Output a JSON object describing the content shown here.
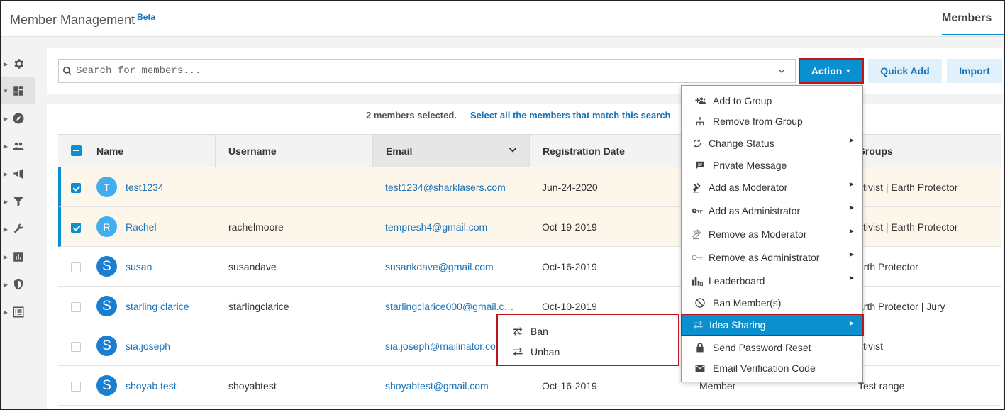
{
  "header": {
    "title": "Member Management",
    "badge": "Beta",
    "tab": "Members"
  },
  "sidebar": {
    "items": [
      {
        "icon": "gear-icon"
      },
      {
        "icon": "dashboard-icon",
        "active": true
      },
      {
        "icon": "compass-icon"
      },
      {
        "icon": "people-icon"
      },
      {
        "icon": "megaphone-icon"
      },
      {
        "icon": "filter-icon"
      },
      {
        "icon": "wrench-icon"
      },
      {
        "icon": "bar-chart-icon"
      },
      {
        "icon": "shield-icon"
      },
      {
        "icon": "list-icon"
      }
    ]
  },
  "search": {
    "placeholder": "Search for members...",
    "value": ""
  },
  "toolbar": {
    "action_label": "Action",
    "quick_add_label": "Quick Add",
    "import_label": "Import"
  },
  "selection": {
    "count_text": "2 members selected.",
    "select_all_text": "Select all the members that match this search"
  },
  "table": {
    "columns": [
      "Name",
      "Username",
      "Email",
      "Registration Date",
      "",
      "Groups"
    ],
    "rows": [
      {
        "initial": "T",
        "name": "test1234",
        "username": "",
        "email": "test1234@sharklasers.com",
        "date": "Jun-24-2020",
        "status": "",
        "groups": "ctivist | Earth Protector",
        "selected": true
      },
      {
        "initial": "R",
        "name": "Rachel",
        "username": "rachelmoore",
        "email": "tempresh4@gmail.com",
        "date": "Oct-19-2019",
        "status": "",
        "groups": "ctivist | Earth Protector",
        "selected": true
      },
      {
        "initial": "S",
        "name": "susan",
        "username": "susandave",
        "email": "susankdave@gmail.com",
        "date": "Oct-16-2019",
        "status": "",
        "groups": "arth Protector",
        "selected": false
      },
      {
        "initial": "S",
        "name": "starling clarice",
        "username": "starlingclarice",
        "email": "starlingclarice000@gmail.c…",
        "date": "Oct-10-2019",
        "status": "",
        "groups": "arth Protector | Jury",
        "selected": false
      },
      {
        "initial": "S",
        "name": "sia.joseph",
        "username": "",
        "email": "sia.joseph@mailinator.cor",
        "date": "",
        "status": "",
        "groups": "ctivist",
        "selected": false
      },
      {
        "initial": "S",
        "name": "shoyab test",
        "username": "shoyabtest",
        "email": "shoyabtest@gmail.com",
        "date": "Oct-16-2019",
        "status": "Member",
        "groups": "Test range",
        "selected": false
      }
    ]
  },
  "action_menu": {
    "items": [
      {
        "label": "Add to Group",
        "icon": "add-group-icon",
        "submenu": false
      },
      {
        "label": "Remove from Group",
        "icon": "hierarchy-icon",
        "submenu": false
      },
      {
        "label": "Change Status",
        "icon": "refresh-icon",
        "submenu": true
      },
      {
        "label": "Private Message",
        "icon": "message-icon",
        "submenu": false
      },
      {
        "label": "Add as Moderator",
        "icon": "gavel-icon",
        "submenu": true
      },
      {
        "label": "Add as Administrator",
        "icon": "key-icon",
        "submenu": true
      },
      {
        "label": "Remove as Moderator",
        "icon": "gavel-outline-icon",
        "submenu": true
      },
      {
        "label": "Remove as Administrator",
        "icon": "key-outline-icon",
        "submenu": true
      },
      {
        "label": "Leaderboard",
        "icon": "leaderboard-icon",
        "submenu": true
      },
      {
        "label": "Ban Member(s)",
        "icon": "ban-icon",
        "submenu": false
      },
      {
        "label": "Idea Sharing",
        "icon": "swap-icon",
        "submenu": true,
        "highlighted": true
      },
      {
        "label": "Send Password Reset",
        "icon": "lock-icon",
        "submenu": false
      },
      {
        "label": "Email Verification Code",
        "icon": "mail-icon",
        "submenu": false
      }
    ]
  },
  "idea_sharing_menu": {
    "items": [
      {
        "label": "Ban",
        "icon": "swap-cross-icon"
      },
      {
        "label": "Unban",
        "icon": "swap-icon"
      }
    ]
  },
  "colors": {
    "accent": "#0a8fcf",
    "link": "#1a73b8",
    "highlight_border": "#c0141b",
    "selected_row": "#fdf6ea"
  }
}
